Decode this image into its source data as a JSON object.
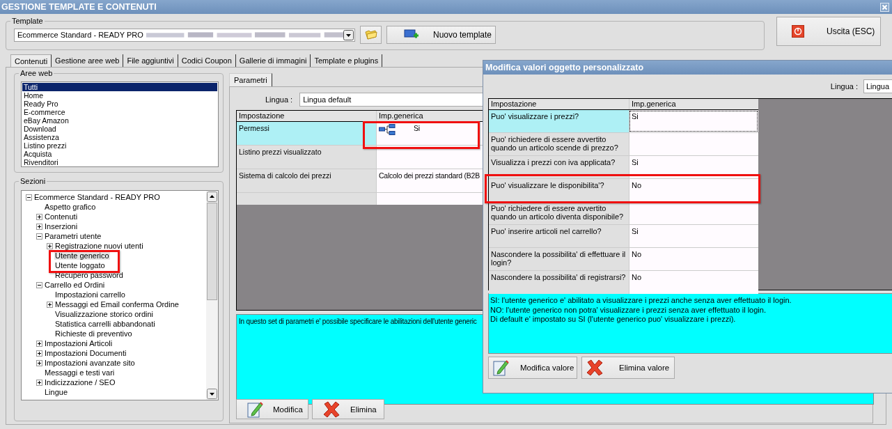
{
  "window": {
    "title": "GESTIONE TEMPLATE E CONTENUTI"
  },
  "template": {
    "label": "Template",
    "value": "Ecommerce Standard - READY PRO",
    "new_button": "Nuovo template"
  },
  "exit_button": "Uscita (ESC)",
  "tabs": [
    {
      "label": "Contenuti",
      "selected": true
    },
    {
      "label": "Gestione aree web",
      "selected": false
    },
    {
      "label": "File aggiuntivi",
      "selected": false
    },
    {
      "label": "Codici Coupon",
      "selected": false
    },
    {
      "label": "Gallerie di immagini",
      "selected": false
    },
    {
      "label": "Template e plugins",
      "selected": false
    }
  ],
  "web_areas": {
    "label": "Aree web",
    "items": [
      {
        "label": "Tutti",
        "selected": true
      },
      {
        "label": "Home",
        "selected": false
      },
      {
        "label": "Ready Pro",
        "selected": false
      },
      {
        "label": "E-commerce",
        "selected": false
      },
      {
        "label": "eBay Amazon",
        "selected": false
      },
      {
        "label": "Download",
        "selected": false
      },
      {
        "label": "Assistenza",
        "selected": false
      },
      {
        "label": "Listino prezzi",
        "selected": false
      },
      {
        "label": "Acquista",
        "selected": false
      },
      {
        "label": "Rivenditori",
        "selected": false
      }
    ]
  },
  "sections": {
    "label": "Sezioni",
    "tree": [
      {
        "label": "Ecommerce Standard - READY PRO",
        "selected": false,
        "expanded": true,
        "children": [
          {
            "label": "Aspetto grafico",
            "selected": false
          },
          {
            "label": "Contenuti",
            "selected": false,
            "expanded": false
          },
          {
            "label": "Inserzioni",
            "selected": false,
            "expanded": false
          },
          {
            "label": "Parametri utente",
            "selected": false,
            "expanded": true,
            "children": [
              {
                "label": "Registrazione nuovi utenti",
                "selected": false,
                "expanded": false
              },
              {
                "label": "Utente generico",
                "selected": true
              },
              {
                "label": "Utente loggato",
                "selected": false
              },
              {
                "label": "Recupero password",
                "selected": false
              }
            ]
          },
          {
            "label": "Carrello ed Ordini",
            "selected": false,
            "expanded": true,
            "children": [
              {
                "label": "Impostazioni carrello",
                "selected": false
              },
              {
                "label": "Messaggi ed Email conferma Ordine",
                "selected": false,
                "expanded": false
              },
              {
                "label": "Visualizzazione storico ordini",
                "selected": false
              },
              {
                "label": "Statistica carrelli abbandonati",
                "selected": false
              },
              {
                "label": "Richieste di preventivo",
                "selected": false
              }
            ]
          },
          {
            "label": "Impostazioni Articoli",
            "selected": false,
            "expanded": false
          },
          {
            "label": "Impostazioni Documenti",
            "selected": false,
            "expanded": false
          },
          {
            "label": "Impostazioni avanzate sito",
            "selected": false,
            "expanded": false
          },
          {
            "label": "Messaggi e testi vari",
            "selected": false
          },
          {
            "label": "Indicizzazione / SEO",
            "selected": false,
            "expanded": false
          },
          {
            "label": "Lingue",
            "selected": false
          }
        ]
      }
    ]
  },
  "parameters": {
    "tab": "Parametri",
    "language_label": "Lingua :",
    "language_value": "Lingua default",
    "columns": [
      "Impostazione",
      "Imp.generica"
    ],
    "rows": [
      {
        "setting": "Permessi",
        "value": "Si",
        "kind": "hierarchy",
        "selected": true
      },
      {
        "setting": "Listino prezzi visualizzato",
        "kind": "text",
        "selected": false
      },
      {
        "setting": "Sistema di calcolo dei prezzi",
        "value": "Calcolo dei prezzi standard (B2B",
        "kind": "text",
        "selected": false
      }
    ],
    "description": "In questo set di parametri e' possibile specificare le abilitazioni dell'utente generic",
    "buttons": [
      {
        "label": "Modifica",
        "kind": "edit"
      },
      {
        "label": "Elimina",
        "kind": "delete"
      }
    ]
  },
  "dialog": {
    "title": "Modifica valori oggetto personalizzato",
    "language_label": "Lingua :",
    "language_value": "Lingua",
    "columns": [
      "Impostazione",
      "Imp.generica"
    ],
    "rows": [
      {
        "setting": "Puo' visualizzare i prezzi?",
        "value": "Si",
        "selected": true
      },
      {
        "setting": "Puo' richiedere di essere avvertito quando un articolo scende di prezzo?",
        "selected": false
      },
      {
        "setting": "Visualizza i prezzi con iva applicata?",
        "value": "Si",
        "selected": false
      },
      {
        "setting": "Puo' visualizzare le disponibilita'?",
        "value": "No",
        "selected": false
      },
      {
        "setting": "Puo' richiedere di essere avvertito quando un articolo diventa disponibile?",
        "selected": false
      },
      {
        "setting": "Puo' inserire articoli nel carrello?",
        "value": "Si",
        "selected": false
      },
      {
        "setting": "Nascondere la possibilita' di effettuare il login?",
        "value": "No",
        "selected": false
      },
      {
        "setting": "Nascondere la possibilita' di registrarsi?",
        "value": "No",
        "selected": false
      }
    ],
    "description": [
      "SI: l'utente generico e' abilitato a visualizzare i prezzi anche senza aver effettuato il login.",
      "NO: l'utente generico non potra' visualizzare i prezzi senza aver effettuato il login.",
      "Di default e' impostato su SI (l'utente generico puo' visualizzare i prezzi)."
    ],
    "buttons": [
      {
        "label": "Modifica valore",
        "kind": "edit"
      },
      {
        "label": "Elimina valore",
        "kind": "delete"
      }
    ]
  }
}
